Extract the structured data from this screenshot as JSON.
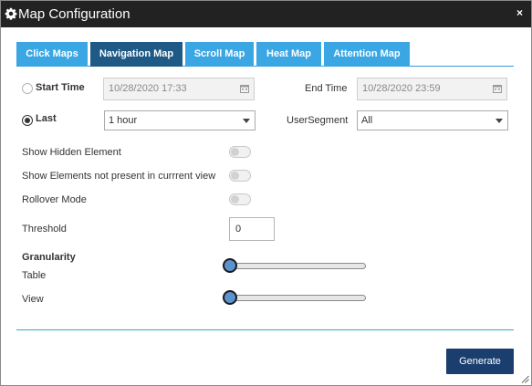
{
  "window": {
    "title": "Map Configuration",
    "close_glyph": "×",
    "gear_icon": "gear-icon"
  },
  "tabs": [
    {
      "label": "Click Maps",
      "active": false
    },
    {
      "label": "Navigation Map",
      "active": true
    },
    {
      "label": "Scroll Map",
      "active": false
    },
    {
      "label": "Heat Map",
      "active": false
    },
    {
      "label": "Attention Map",
      "active": false
    }
  ],
  "time": {
    "start_label": "Start Time",
    "start_value": "10/28/2020 17:33",
    "end_label": "End Time",
    "end_value": "10/28/2020 23:59",
    "last_label": "Last",
    "last_value": "1 hour",
    "selected_mode": "last"
  },
  "segment": {
    "label": "UserSegment",
    "value": "All"
  },
  "toggles": [
    {
      "label": "Show Hidden Element",
      "on": false
    },
    {
      "label": "Show Elements not present in currrent view",
      "on": false
    },
    {
      "label": "Rollover Mode",
      "on": false
    }
  ],
  "threshold": {
    "label": "Threshold",
    "value": "0"
  },
  "granularity": {
    "heading": "Granularity",
    "table_label": "Table",
    "table_level": 0,
    "view_label": "View",
    "view_level": 0
  },
  "actions": {
    "generate_label": "Generate"
  },
  "colors": {
    "titlebar": "#222222",
    "tab": "#3aa6e4",
    "tab_active": "#1f5a86",
    "button": "#1a3f6f",
    "divider": "#2eaeb8",
    "slider_thumb": "#5b93cf"
  }
}
